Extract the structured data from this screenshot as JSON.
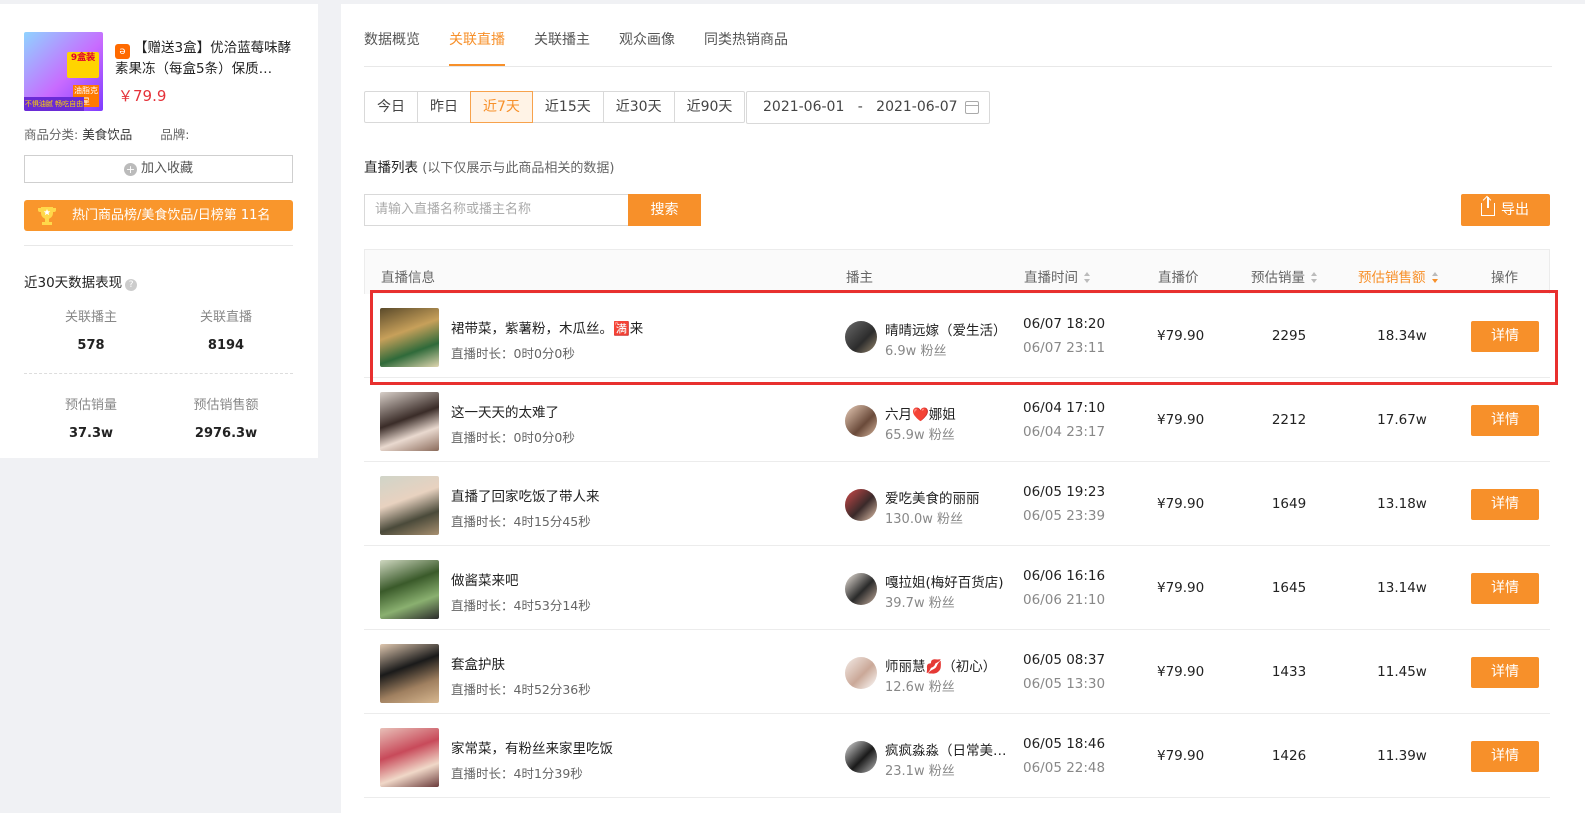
{
  "product": {
    "title": "【赠送3盒】优洽蓝莓味酵素果冻（每盒5条）保质…",
    "price": "￥79.9",
    "category_label": "商品分类:",
    "category_value": "美食饮品",
    "brand_label": "品牌:",
    "brand_value": "",
    "fav_button": "加入收藏",
    "rank_text": "热门商品榜/美食饮品/日榜第 11名",
    "thumb_badge": "9盒装",
    "thumb_strip": "不惧油腻 畅吃自由",
    "thumb_badge2": "油脂克星"
  },
  "stats": {
    "title": "近30天数据表现",
    "items": [
      {
        "label": "关联播主",
        "value": "578"
      },
      {
        "label": "关联直播",
        "value": "8194"
      },
      {
        "label": "预估销量",
        "value": "37.3w"
      },
      {
        "label": "预估销售额",
        "value": "2976.3w"
      }
    ]
  },
  "tabs": [
    "数据概览",
    "关联直播",
    "关联播主",
    "观众画像",
    "同类热销商品"
  ],
  "active_tab": "关联直播",
  "date_buttons": [
    "今日",
    "昨日",
    "近7天",
    "近15天",
    "近30天",
    "近90天"
  ],
  "active_date": "近7天",
  "date_range": {
    "start": "2021-06-01",
    "sep": "-",
    "end": "2021-06-07"
  },
  "list": {
    "title": "直播列表",
    "subtitle": "(以下仅展示与此商品相关的数据)",
    "search_placeholder": "请输入直播名称或播主名称",
    "search_button": "搜索",
    "export_button": "导出"
  },
  "table": {
    "headers": {
      "info": "直播信息",
      "anchor": "播主",
      "time": "直播时间",
      "price": "直播价",
      "qty": "预估销量",
      "amount": "预估销售额",
      "op": "操作"
    },
    "rows": [
      {
        "title": "裙带菜，紫薯粉，木瓜丝。🈵来",
        "duration": "直播时长：0时0分0秒",
        "anchor": "晴晴远嫁（爱生活）",
        "fans": "6.9w 粉丝",
        "start": "06/07 18:20",
        "end": "06/07 23:11",
        "price": "¥79.90",
        "qty": "2295",
        "amount": "18.34w",
        "action": "详情"
      },
      {
        "title": "这一天天的太难了",
        "duration": "直播时长：0时0分0秒",
        "anchor": "六月❤️娜姐",
        "fans": "65.9w 粉丝",
        "start": "06/04 17:10",
        "end": "06/04 23:17",
        "price": "¥79.90",
        "qty": "2212",
        "amount": "17.67w",
        "action": "详情"
      },
      {
        "title": "直播了回家吃饭了带人来",
        "duration": "直播时长：4时15分45秒",
        "anchor": "爱吃美食的丽丽",
        "fans": "130.0w 粉丝",
        "start": "06/05 19:23",
        "end": "06/05 23:39",
        "price": "¥79.90",
        "qty": "1649",
        "amount": "13.18w",
        "action": "详情"
      },
      {
        "title": "做酱菜来吧",
        "duration": "直播时长：4时53分14秒",
        "anchor": "嘎拉姐(梅好百货店)",
        "fans": "39.7w 粉丝",
        "start": "06/06 16:16",
        "end": "06/06 21:10",
        "price": "¥79.90",
        "qty": "1645",
        "amount": "13.14w",
        "action": "详情"
      },
      {
        "title": "套盒护肤",
        "duration": "直播时长：4时52分36秒",
        "anchor": "师丽慧💋（初心）",
        "fans": "12.6w 粉丝",
        "start": "06/05 08:37",
        "end": "06/05 13:30",
        "price": "¥79.90",
        "qty": "1433",
        "amount": "11.45w",
        "action": "详情"
      },
      {
        "title": "家常菜，有粉丝来家里吃饭",
        "duration": "直播时长：4时1分39秒",
        "anchor": "疯疯淼淼（日常美…",
        "fans": "23.1w 粉丝",
        "start": "06/05 18:46",
        "end": "06/05 22:48",
        "price": "¥79.90",
        "qty": "1426",
        "amount": "11.39w",
        "action": "详情"
      }
    ]
  },
  "colors": {
    "accent": "#f7902a",
    "price_red": "#e5323a",
    "highlight": "#e8302f"
  }
}
